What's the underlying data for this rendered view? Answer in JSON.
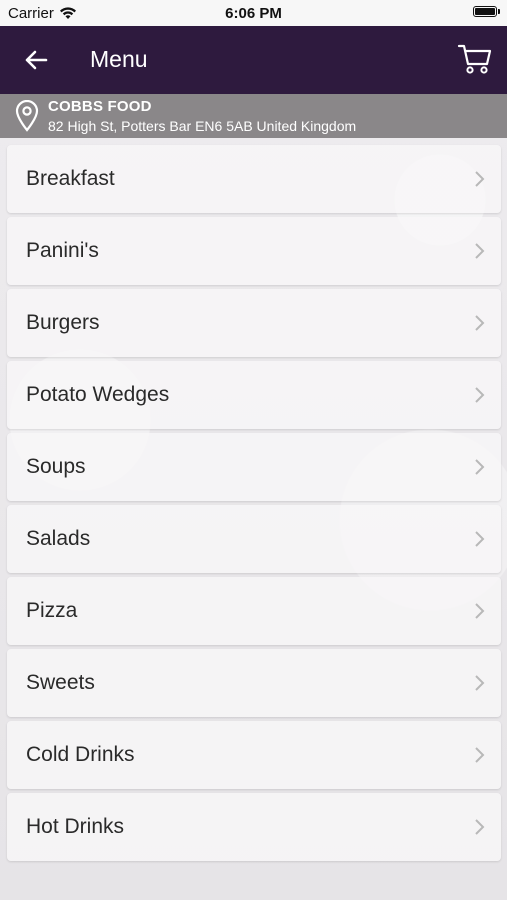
{
  "status": {
    "carrier": "Carrier",
    "time": "6:06 PM"
  },
  "navbar": {
    "title": "Menu",
    "back_icon": "back-arrow-icon",
    "cart_icon": "cart-icon"
  },
  "location": {
    "name": "COBBS FOOD",
    "address": "82 High St, Potters Bar EN6 5AB United Kingdom"
  },
  "menu": [
    {
      "label": "Breakfast"
    },
    {
      "label": "Panini's"
    },
    {
      "label": "Burgers"
    },
    {
      "label": "Potato Wedges"
    },
    {
      "label": "Soups"
    },
    {
      "label": "Salads"
    },
    {
      "label": "Pizza"
    },
    {
      "label": "Sweets"
    },
    {
      "label": "Cold Drinks"
    },
    {
      "label": "Hot Drinks"
    }
  ],
  "colors": {
    "navbar": "#2e1a3e",
    "location_bar": "#8a8789"
  }
}
